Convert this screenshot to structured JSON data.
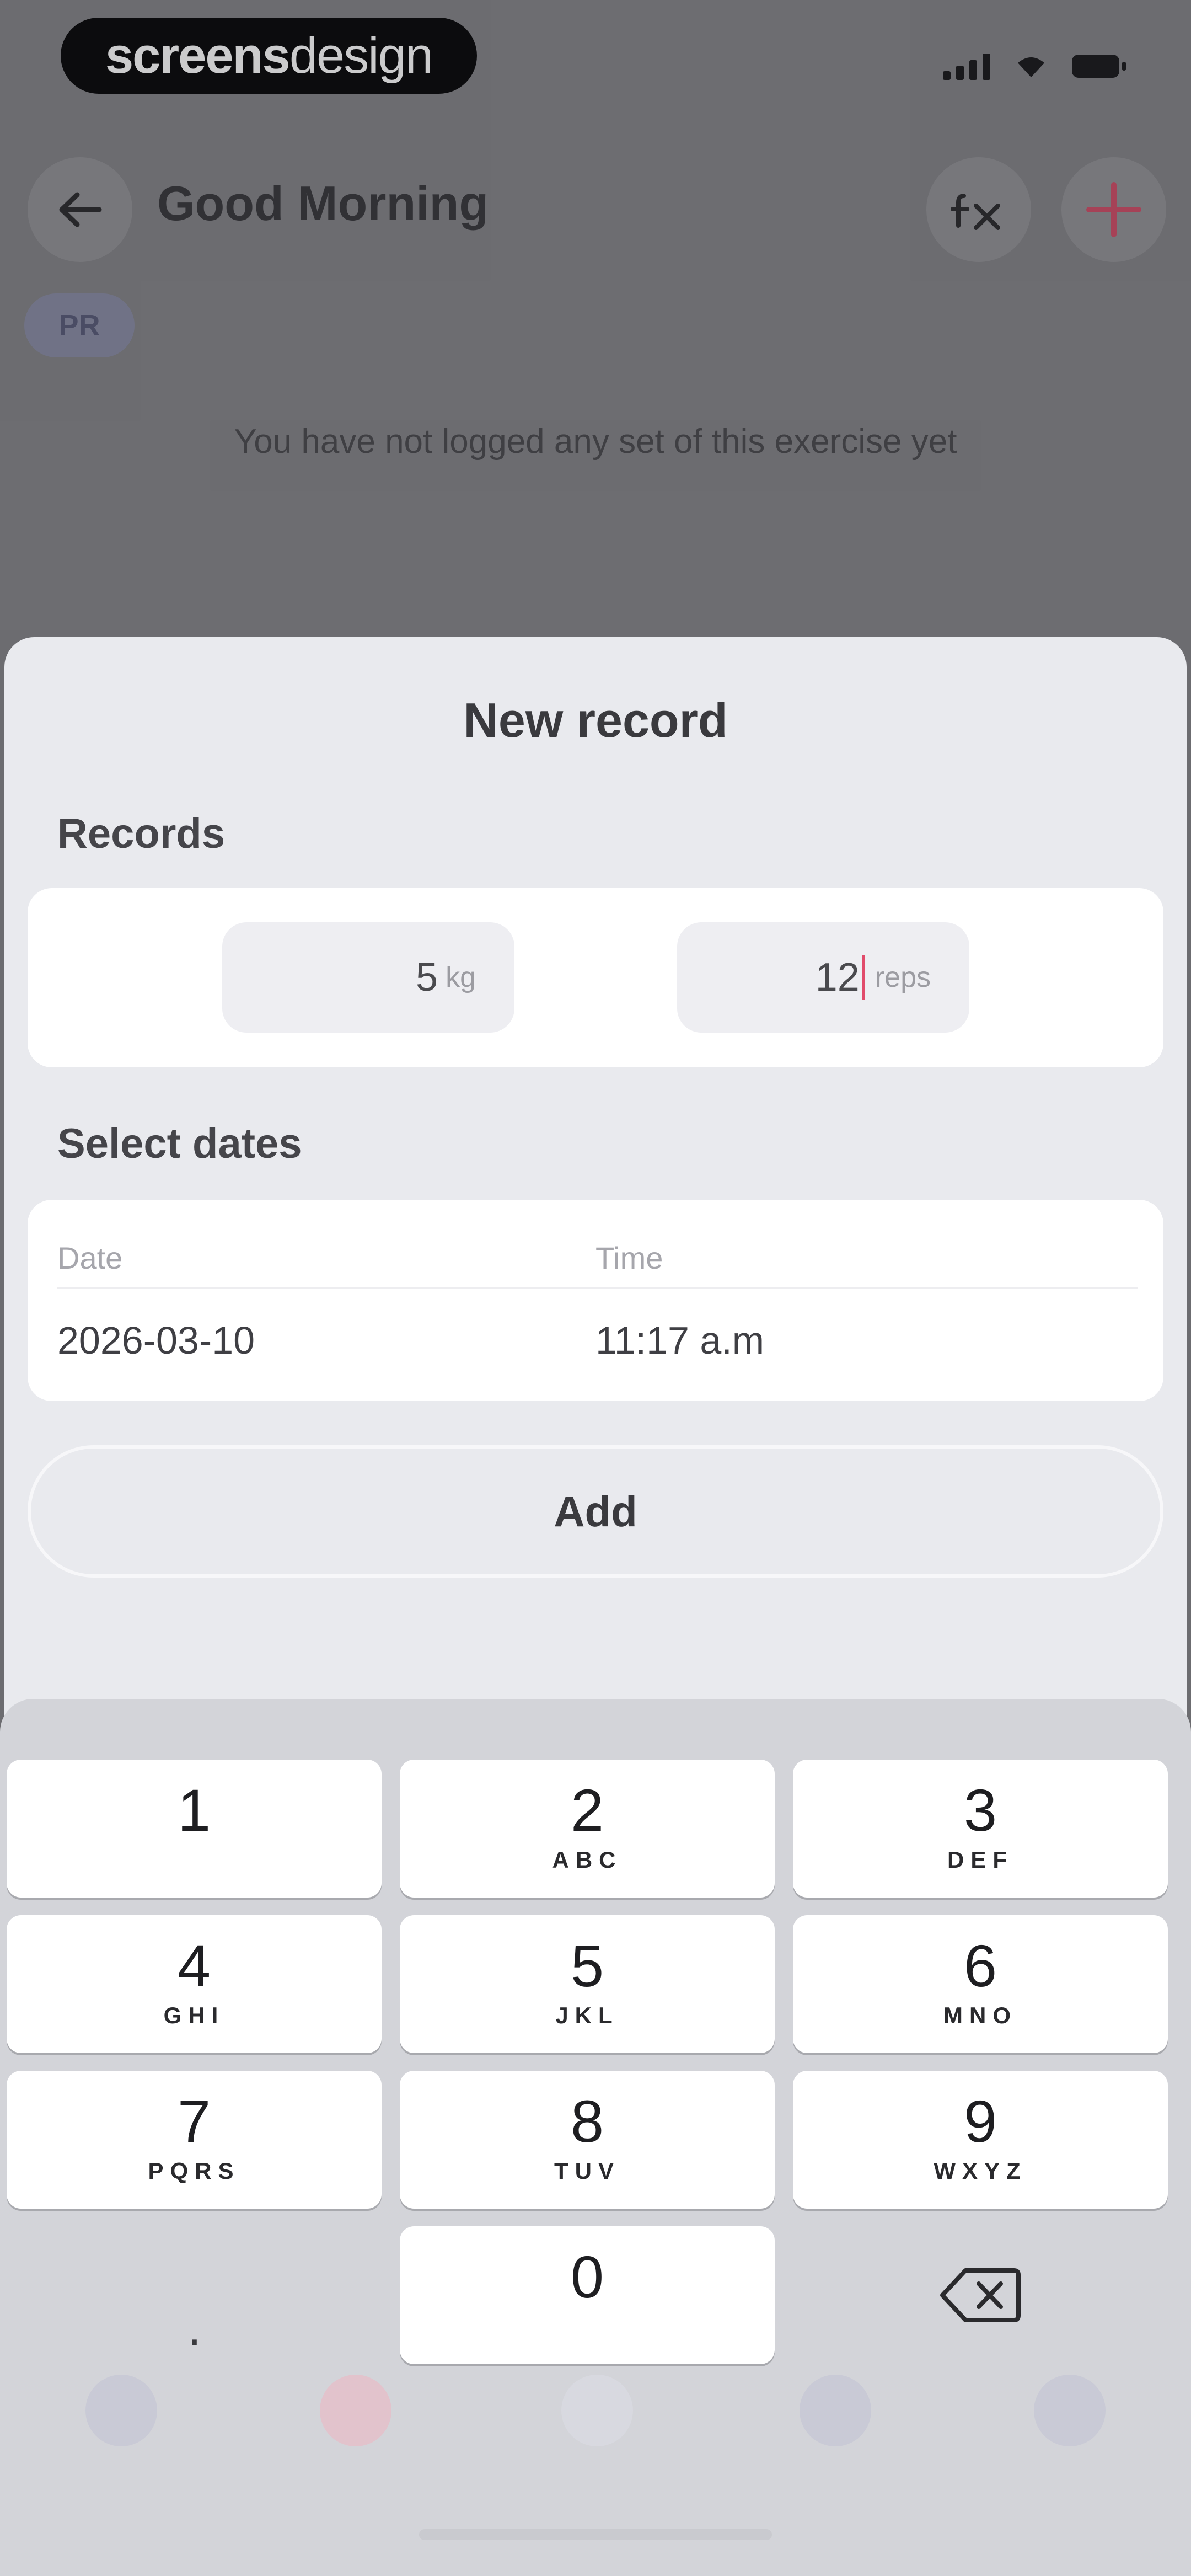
{
  "status_bar": {
    "brand_bold": "screens",
    "brand_light": "design"
  },
  "header": {
    "title": "Good Morning",
    "pr_badge": "PR"
  },
  "empty_state": "You have not logged any set of this exercise yet",
  "sheet": {
    "title": "New record",
    "records_label": "Records",
    "weight": {
      "value": "5",
      "unit": "kg"
    },
    "reps": {
      "value": "12",
      "unit": "reps"
    },
    "dates_label": "Select dates",
    "date_label": "Date",
    "time_label": "Time",
    "date_value": "2026-03-10",
    "time_value": "11:17 a.m",
    "add_label": "Add"
  },
  "keypad": [
    {
      "num": "1",
      "letters": ""
    },
    {
      "num": "2",
      "letters": "ABC"
    },
    {
      "num": "3",
      "letters": "DEF"
    },
    {
      "num": "4",
      "letters": "GHI"
    },
    {
      "num": "5",
      "letters": "JKL"
    },
    {
      "num": "6",
      "letters": "MNO"
    },
    {
      "num": "7",
      "letters": "PQRS"
    },
    {
      "num": "8",
      "letters": "TUV"
    },
    {
      "num": "9",
      "letters": "WXYZ"
    },
    {
      "num": "0",
      "letters": ""
    }
  ],
  "keypad_decimal": ".",
  "icons": {
    "back": "arrow-left-icon",
    "clear": "fx-clear-icon",
    "add": "plus-icon",
    "delete": "backspace-icon"
  },
  "colors": {
    "accent": "#e14b6b",
    "sheet_bg": "#e9eaee",
    "keyboard_bg": "#d3d4d9"
  }
}
